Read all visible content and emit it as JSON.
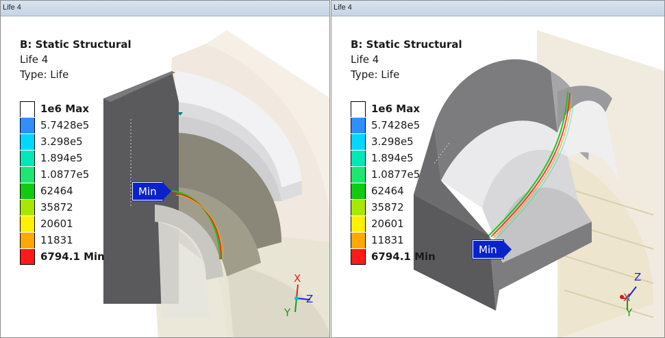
{
  "viewports": [
    {
      "title": "Life 4",
      "analysis_title": "B: Static Structural",
      "result_name": "Life 4",
      "result_type": "Type: Life",
      "legend": [
        {
          "label": "1e6 Max",
          "color": "#ffffff",
          "bold": true
        },
        {
          "label": "5.7428e5",
          "color": "#2f8fff"
        },
        {
          "label": "3.298e5",
          "color": "#00d8ff"
        },
        {
          "label": "1.894e5",
          "color": "#00e8b8"
        },
        {
          "label": "1.0877e5",
          "color": "#1ee670"
        },
        {
          "label": "62464",
          "color": "#10cc10"
        },
        {
          "label": "35872",
          "color": "#a8e800"
        },
        {
          "label": "20601",
          "color": "#fff000"
        },
        {
          "label": "11831",
          "color": "#ffa800"
        },
        {
          "label": "6794.1 Min",
          "color": "#ff1a1a",
          "bold": true
        }
      ],
      "probe_label": "Min",
      "triad": {
        "x": "X",
        "z": "Z",
        "y": "Y"
      }
    },
    {
      "title": "Life 4",
      "analysis_title": "B: Static Structural",
      "result_name": "Life 4",
      "result_type": "Type: Life",
      "legend": [
        {
          "label": "1e6 Max",
          "color": "#ffffff",
          "bold": true
        },
        {
          "label": "5.7428e5",
          "color": "#2f8fff"
        },
        {
          "label": "3.298e5",
          "color": "#00d8ff"
        },
        {
          "label": "1.894e5",
          "color": "#00e8b8"
        },
        {
          "label": "1.0877e5",
          "color": "#1ee670"
        },
        {
          "label": "62464",
          "color": "#10cc10"
        },
        {
          "label": "35872",
          "color": "#a8e800"
        },
        {
          "label": "20601",
          "color": "#fff000"
        },
        {
          "label": "11831",
          "color": "#ffa800"
        },
        {
          "label": "6794.1 Min",
          "color": "#ff1a1a",
          "bold": true
        }
      ],
      "probe_label": "Min",
      "triad": {
        "z": "Z",
        "x": "X",
        "y": "Y"
      }
    }
  ]
}
